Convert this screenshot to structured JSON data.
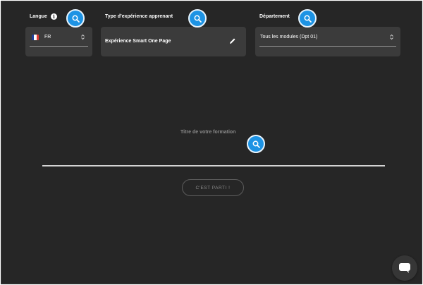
{
  "language": {
    "label": "Langue",
    "info_icon": "info-icon",
    "selected": "FR",
    "flag_colors": [
      "#1f3f99",
      "#ffffff",
      "#e33b33"
    ]
  },
  "experience": {
    "label": "Type d'expérience apprenant",
    "value": "Expérience Smart One Page",
    "edit_icon": "pencil-icon"
  },
  "department": {
    "label": "Département",
    "selected": "Tous les modules (Dpt 01)"
  },
  "training": {
    "title_label": "Titre de votre formation",
    "title_value": ""
  },
  "actions": {
    "go_label": "C'EST PARTI !"
  },
  "chat": {
    "icon": "chat-bubble-icon"
  },
  "colors": {
    "background": "#262626",
    "card": "#3b3b3b",
    "accent": "#1d93e4"
  }
}
